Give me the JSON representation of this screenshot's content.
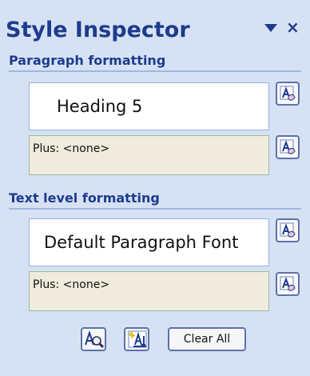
{
  "panel": {
    "title": "Style Inspector",
    "paragraph_section": {
      "header": "Paragraph formatting",
      "style_value": "Heading 5",
      "plus_value": "Plus: <none>"
    },
    "text_section": {
      "header": "Text level formatting",
      "style_value": "Default Paragraph Font",
      "plus_value": "Plus: <none>"
    },
    "bottom": {
      "clear_all_label": "Clear All"
    }
  }
}
